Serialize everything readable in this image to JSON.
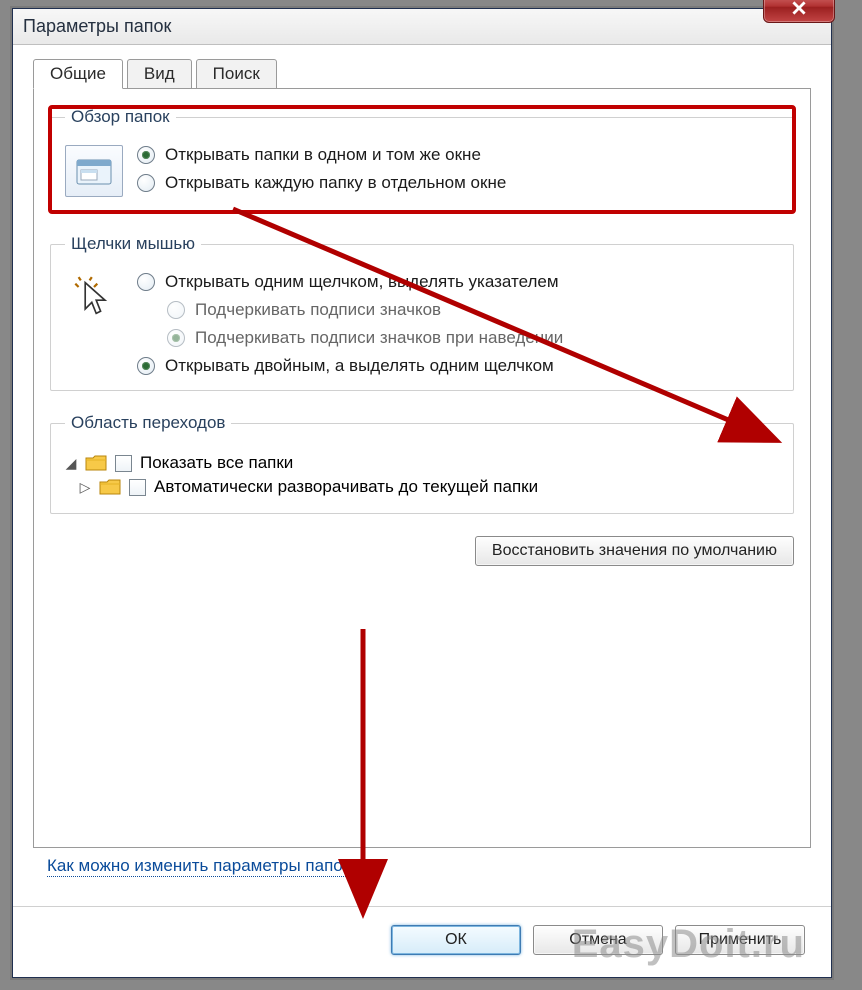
{
  "window": {
    "title": "Параметры папок"
  },
  "tabs": {
    "general": "Общие",
    "view": "Вид",
    "search": "Поиск"
  },
  "group_browse": {
    "legend": "Обзор папок",
    "opt_same_window": "Открывать папки в одном и том же окне",
    "opt_separate_window": "Открывать каждую папку в отдельном окне"
  },
  "group_click": {
    "legend": "Щелчки мышью",
    "opt_single_click": "Открывать одним щелчком, выделять указателем",
    "sub_underline_always": "Подчеркивать подписи значков",
    "sub_underline_hover": "Подчеркивать подписи значков при наведении",
    "opt_double_click": "Открывать двойным, а выделять одним щелчком"
  },
  "group_nav": {
    "legend": "Область переходов",
    "chk_show_all": "Показать все папки",
    "chk_auto_expand": "Автоматически разворачивать до текущей папки"
  },
  "restore_defaults": "Восстановить значения по умолчанию",
  "help_link": "Как можно изменить параметры папок?",
  "buttons": {
    "ok": "ОК",
    "cancel": "Отмена",
    "apply": "Применить"
  },
  "watermark": "EasyDoit.ru"
}
